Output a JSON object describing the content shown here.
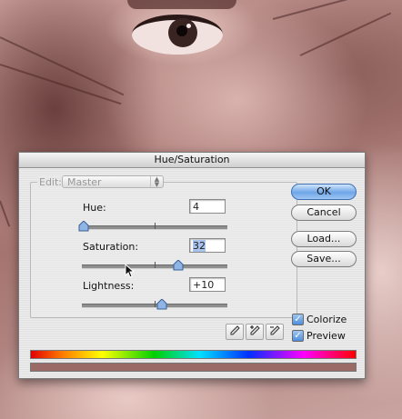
{
  "dialog": {
    "title": "Hue/Saturation",
    "edit": {
      "label": "Edit:",
      "selected": "Master"
    },
    "hue": {
      "label": "Hue:",
      "value": "4",
      "level": 0.011
    },
    "saturation": {
      "label": "Saturation:",
      "value": "32",
      "level": 0.66
    },
    "lightness": {
      "label": "Lightness:",
      "value": "+10",
      "level": 0.55
    },
    "buttons": {
      "ok": "OK",
      "cancel": "Cancel",
      "load": "Load...",
      "save": "Save..."
    },
    "colorize": {
      "label": "Colorize",
      "checked": true
    },
    "preview": {
      "label": "Preview",
      "checked": true
    },
    "colors": {
      "accent": "#6fa6e8",
      "colorize_swatch": "#9a6a66"
    },
    "icons": [
      "eyedropper-icon",
      "eyedropper-plus-icon",
      "eyedropper-minus-icon",
      "slider-thumb-icon",
      "mouse-cursor-icon"
    ]
  }
}
